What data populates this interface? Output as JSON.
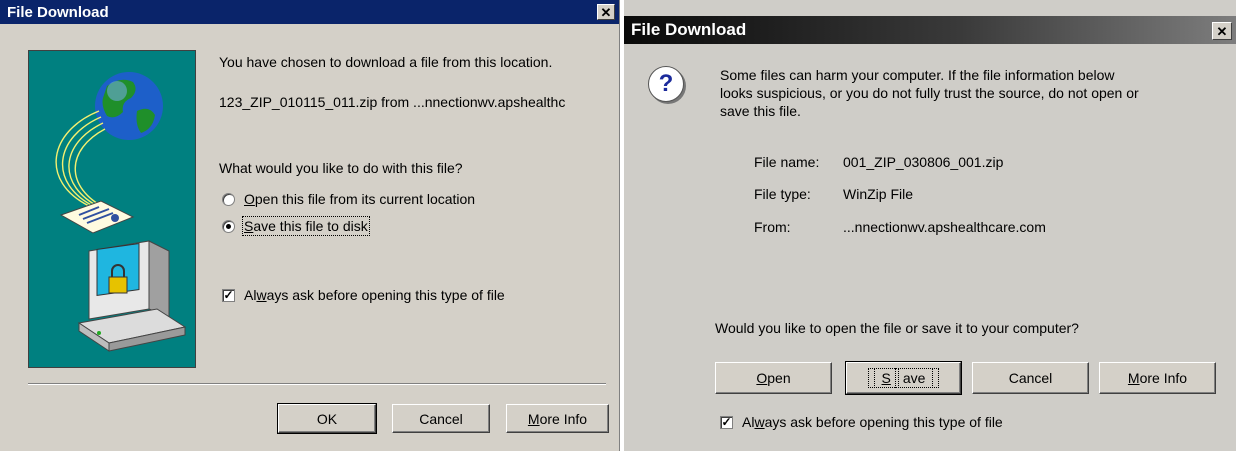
{
  "dialog1": {
    "title": "File Download",
    "close_glyph": "✕",
    "intro": "You have chosen to download a file from this location.",
    "file_location": "123_ZIP_010115_011.zip from ...nnectionwv.apshealthc",
    "question": "What would you like to do with this file?",
    "option_open": {
      "accel": "O",
      "rest": "pen this file from its current location",
      "selected": false
    },
    "option_save": {
      "accel": "S",
      "rest": "ave this file to disk",
      "selected": true
    },
    "always_ask": {
      "pre": "Al",
      "accel": "w",
      "rest": "ays ask before opening this type of file",
      "checked": true
    },
    "buttons": {
      "ok": "OK",
      "cancel": "Cancel",
      "more_info_accel": "M",
      "more_info_rest": "ore Info"
    },
    "illustration_icons": [
      "globe-icon",
      "document-envelope-icon",
      "computer-lock-icon"
    ]
  },
  "dialog2": {
    "title": "File Download",
    "close_glyph": "✕",
    "question_icon": "?",
    "warning_line1": "Some files can harm your computer. If the file information below",
    "warning_line2": "looks suspicious, or you do not fully trust the source, do not open or",
    "warning_line3": "save this file.",
    "file_name_label": "File name:",
    "file_name_value": "001_ZIP_030806_001.zip",
    "file_type_label": "File type:",
    "file_type_value": "WinZip File",
    "from_label": "From:",
    "from_value": "...nnectionwv.apshealthcare.com",
    "prompt": "Would you like to open the file or save it to your computer?",
    "buttons": {
      "open_accel": "O",
      "open_rest": "pen",
      "save_accel": "S",
      "save_rest": "ave",
      "cancel": "Cancel",
      "more_info_accel": "M",
      "more_info_rest": "ore Info"
    },
    "always_ask": {
      "pre": "Al",
      "accel": "w",
      "rest": "ays ask before opening this type of file",
      "checked": true
    }
  },
  "colors": {
    "titlebar_active": "#0a246a",
    "dialog_face": "#d4d0c8",
    "illustration_bg": "#008080"
  }
}
